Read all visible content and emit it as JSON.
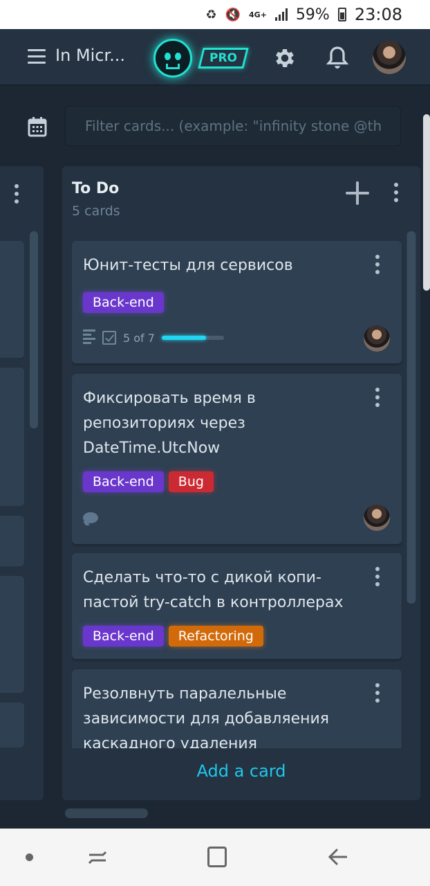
{
  "status_bar": {
    "network": "4G+",
    "battery": "59%",
    "time": "23:08"
  },
  "header": {
    "board_title": "In Micr...",
    "pro_badge": "PRO",
    "icons": [
      "menu-icon",
      "gitkraken-logo",
      "gear-icon",
      "bell-icon",
      "avatar"
    ]
  },
  "filter": {
    "placeholder": "Filter cards... (example: \"infinity stone @th"
  },
  "column": {
    "title": "To Do",
    "count": "5 cards",
    "add_card": "Add a card",
    "cards": [
      {
        "title": "Юнит-тесты для сервисов",
        "labels": [
          "Back-end"
        ],
        "checklist": "5 of 7",
        "checklist_progress": 0.714,
        "has_description": true
      },
      {
        "title": "Фиксировать время в репозиториях через DateTime.UtcNow",
        "labels": [
          "Back-end",
          "Bug"
        ],
        "has_comments": true
      },
      {
        "title": "Сделать что-то с дикой копи-пастой try-catch в контроллерах",
        "labels": [
          "Back-end",
          "Refactoring"
        ]
      },
      {
        "title": "Резолвнуть паралельные зависимости для добавляения каскадного удаления"
      }
    ]
  },
  "colors": {
    "background": "#1c2733",
    "column": "#243241",
    "card": "#2f4052",
    "accent": "#1fc8ee",
    "backend_label": "#6a37cc",
    "bug_label": "#cc2a33",
    "refactoring_label": "#d26a0a"
  }
}
